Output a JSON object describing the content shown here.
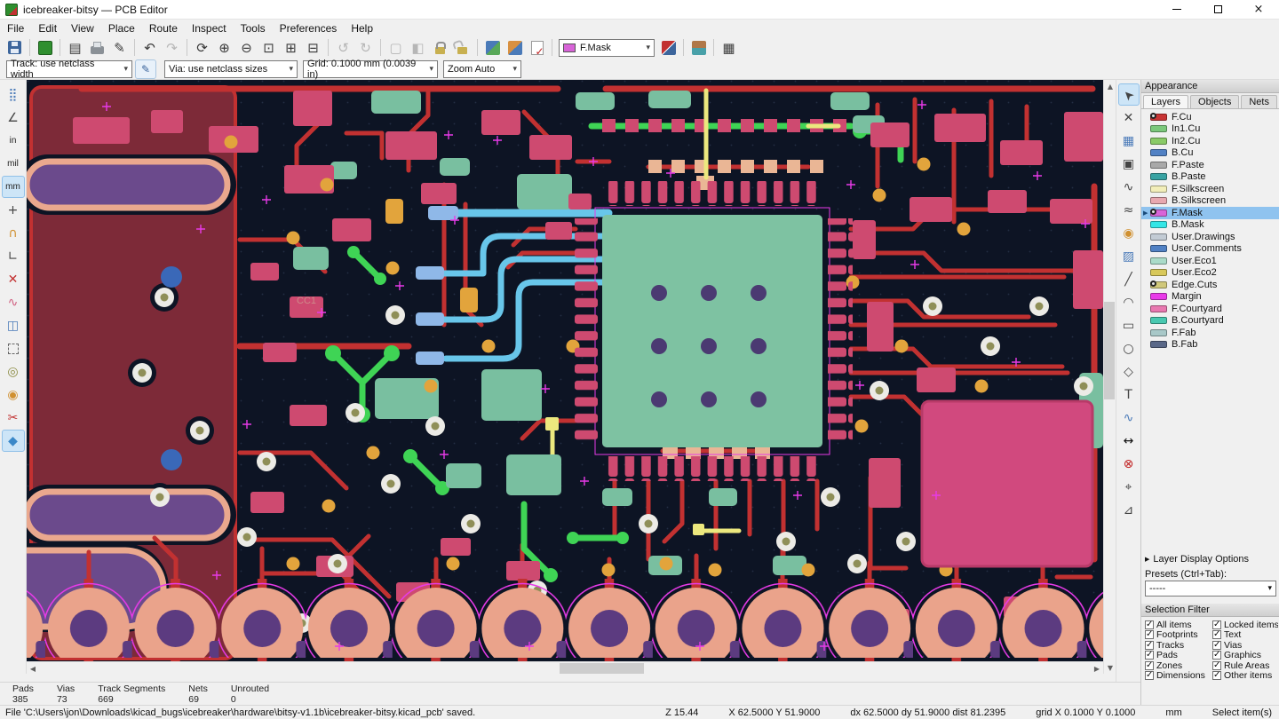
{
  "window": {
    "title": "icebreaker-bitsy — PCB Editor"
  },
  "menubar": {
    "items": [
      "File",
      "Edit",
      "View",
      "Place",
      "Route",
      "Inspect",
      "Tools",
      "Preferences",
      "Help"
    ]
  },
  "toolbar": {
    "active_layer": "F.Mask",
    "active_layer_swatch_style": "background:#d864d8"
  },
  "settings_bar": {
    "track": "Track: use netclass width",
    "via": "Via: use netclass sizes",
    "grid": "Grid: 0.1000 mm (0.0039 in)",
    "zoom": "Zoom Auto"
  },
  "glyphs": {
    "close": "×",
    "chevron": "▾",
    "collapse": "▶",
    "page": "▤",
    "plot": "✎",
    "undo": "↶",
    "redo": "↷",
    "refresh": "⟳",
    "zoom_in": "⊕",
    "zoom_out": "⊖",
    "zoom_fit": "⊡",
    "zoom_objects": "⊞",
    "zoom_sel": "⊟",
    "rotate_ccw": "↺",
    "rotate_cw": "↻",
    "select_a": "▢",
    "select_b": "◧",
    "array": "▦",
    "grid_dots": "⣿",
    "polar": "∠",
    "unit_in": "in",
    "unit_mil": "mil",
    "unit_mm": "mm",
    "cursor_full": "+",
    "magnet": "∩",
    "angle45": "∟",
    "ratsnest_off": "✕",
    "ratsnest_curved": "∿",
    "highlight_net": "◫",
    "pad_display": "◎",
    "via_display": "◉",
    "knife": "✂",
    "zone_display": "◆",
    "sel_arrow": "➤",
    "probe": "✕",
    "local_rats": "▦",
    "footprint": "▣",
    "route": "∿",
    "diffpair": "≈",
    "via": "◉",
    "zone": "▨",
    "line": "╱",
    "arc": "◠",
    "rect": "▭",
    "circle": "○",
    "polygon": "◇",
    "text": "T",
    "spline": "∿",
    "dimension": "↔",
    "delete": "⊗",
    "origin": "⌖",
    "measure": "⊿",
    "edit_sizes": "✎"
  },
  "canvas": {
    "label": "CC1"
  },
  "appearance": {
    "title": "Appearance",
    "tabs": [
      "Layers",
      "Objects",
      "Nets"
    ],
    "layers": [
      {
        "name": "F.Cu",
        "color": "#c83434",
        "eye": true
      },
      {
        "name": "In1.Cu",
        "color": "#7bc87b"
      },
      {
        "name": "In2.Cu",
        "color": "#89ca66"
      },
      {
        "name": "B.Cu",
        "color": "#5181c4"
      },
      {
        "name": "F.Paste",
        "color": "#a8a8a8"
      },
      {
        "name": "B.Paste",
        "color": "#37a2a2"
      },
      {
        "name": "F.Silkscreen",
        "color": "#f2eeb9"
      },
      {
        "name": "B.Silkscreen",
        "color": "#e8a8b0"
      },
      {
        "name": "F.Mask",
        "color": "#d864d8",
        "eye": true,
        "selected": true
      },
      {
        "name": "B.Mask",
        "color": "#33e6e6"
      },
      {
        "name": "User.Drawings",
        "color": "#c2cbd4"
      },
      {
        "name": "User.Comments",
        "color": "#5181c4"
      },
      {
        "name": "User.Eco1",
        "color": "#aadbc8"
      },
      {
        "name": "User.Eco2",
        "color": "#d8c85a"
      },
      {
        "name": "Edge.Cuts",
        "color": "#d0c87a",
        "eye": true
      },
      {
        "name": "Margin",
        "color": "#e83ae8"
      },
      {
        "name": "F.Courtyard",
        "color": "#e878b0"
      },
      {
        "name": "B.Courtyard",
        "color": "#48c8b0"
      },
      {
        "name": "F.Fab",
        "color": "#a8c8c8"
      },
      {
        "name": "B.Fab",
        "color": "#5a6888"
      }
    ]
  },
  "layer_display": {
    "label": "Layer Display Options"
  },
  "presets": {
    "label": "Presets (Ctrl+Tab):",
    "value": "-----"
  },
  "selection_filter": {
    "title": "Selection Filter",
    "items": [
      {
        "label": "All items",
        "checked": true
      },
      {
        "label": "Locked items",
        "checked": true
      },
      {
        "label": "Footprints",
        "checked": true
      },
      {
        "label": "Text",
        "checked": true
      },
      {
        "label": "Tracks",
        "checked": true
      },
      {
        "label": "Vias",
        "checked": true
      },
      {
        "label": "Pads",
        "checked": true
      },
      {
        "label": "Graphics",
        "checked": true
      },
      {
        "label": "Zones",
        "checked": true
      },
      {
        "label": "Rule Areas",
        "checked": true
      },
      {
        "label": "Dimensions",
        "checked": true
      },
      {
        "label": "Other items",
        "checked": true
      }
    ]
  },
  "counts": [
    {
      "label": "Pads",
      "value": "385"
    },
    {
      "label": "Vias",
      "value": "73"
    },
    {
      "label": "Track Segments",
      "value": "669"
    },
    {
      "label": "Nets",
      "value": "69"
    },
    {
      "label": "Unrouted",
      "value": "0"
    }
  ],
  "statusbar": {
    "message": "File 'C:\\Users\\jon\\Downloads\\kicad_bugs\\icebreaker\\hardware\\bitsy-v1.1b\\icebreaker-bitsy.kicad_pcb' saved.",
    "zoom": "Z 15.44",
    "position": "X 62.5000  Y 51.9000",
    "delta": "dx 62.5000  dy 51.9000  dist 81.2395",
    "grid": "grid X 0.1000  Y 0.1000",
    "units": "mm",
    "hint": "Select item(s)"
  }
}
